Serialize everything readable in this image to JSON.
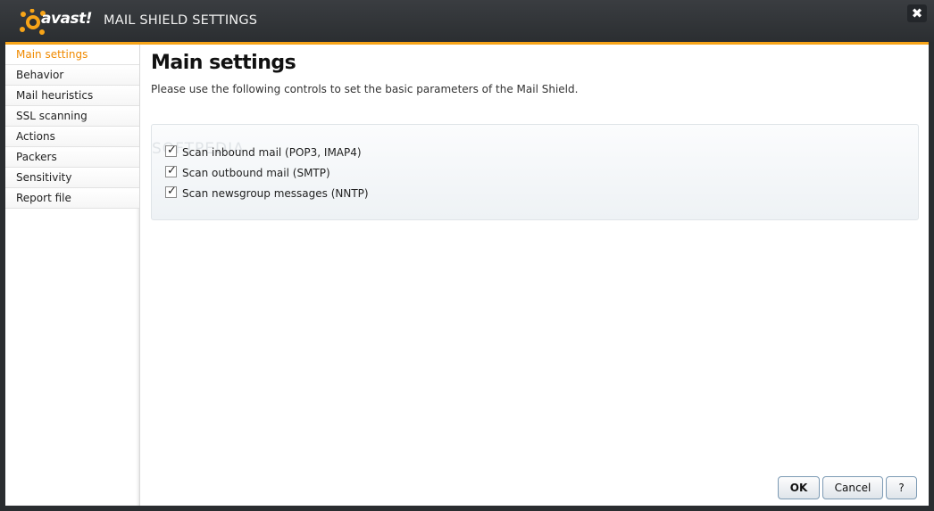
{
  "window": {
    "logo_text": "avast!",
    "title": "MAIL SHIELD SETTINGS",
    "close_label": "✖"
  },
  "sidebar": {
    "items": [
      {
        "label": "Main settings",
        "active": true
      },
      {
        "label": "Behavior"
      },
      {
        "label": "Mail heuristics"
      },
      {
        "label": "SSL scanning"
      },
      {
        "label": "Actions"
      },
      {
        "label": "Packers"
      },
      {
        "label": "Sensitivity"
      },
      {
        "label": "Report file"
      }
    ]
  },
  "main": {
    "title": "Main settings",
    "description": "Please use the following controls to set the basic parameters of the Mail Shield.",
    "watermark": "SOFTPEDIA",
    "options": [
      {
        "label": "Scan inbound mail (POP3, IMAP4)",
        "checked": true
      },
      {
        "label": "Scan outbound mail (SMTP)",
        "checked": true
      },
      {
        "label": "Scan newsgroup messages (NNTP)",
        "checked": true
      }
    ]
  },
  "buttons": {
    "ok": "OK",
    "cancel": "Cancel",
    "help": "?"
  },
  "colors": {
    "accent": "#f7a418",
    "titlebar": "#2b2e31",
    "active_item": "#f08a00"
  }
}
